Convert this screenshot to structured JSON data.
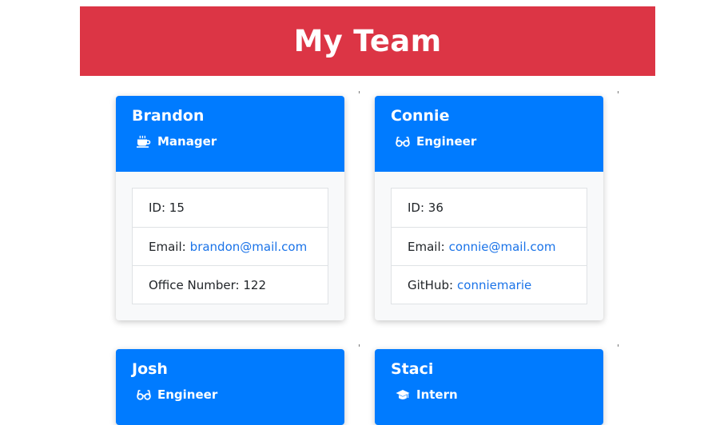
{
  "header": {
    "title": "My Team"
  },
  "cards": [
    {
      "name": "Brandon",
      "role": "Manager",
      "icon": "coffee-icon",
      "id": "ID: 15",
      "email_label": "Email:",
      "email": "brandon@mail.com",
      "extra_label": "Office Number: 122"
    },
    {
      "name": "Connie",
      "role": "Engineer",
      "icon": "glasses-icon",
      "id": "ID: 36",
      "email_label": "Email:",
      "email": "connie@mail.com",
      "extra_label": "GitHub:",
      "extra_link": "conniemarie"
    },
    {
      "name": "Josh",
      "role": "Engineer",
      "icon": "glasses-icon"
    },
    {
      "name": "Staci",
      "role": "Intern",
      "icon": "graduation-cap-icon"
    }
  ],
  "stray_marks": [
    "'",
    "'",
    "'",
    "'"
  ],
  "colors": {
    "header_bg": "#dc3545",
    "card_header_bg": "#007bff",
    "link": "#1a73e8"
  }
}
